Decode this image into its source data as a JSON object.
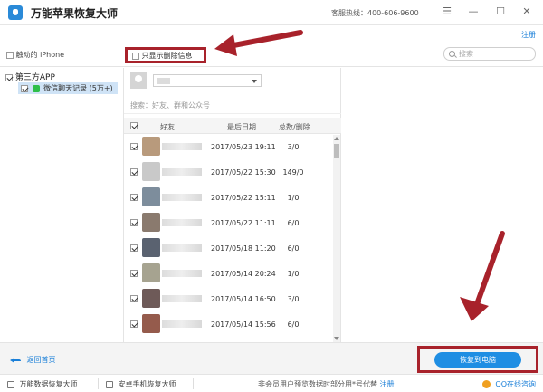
{
  "titlebar": {
    "title": "万能苹果恢复大师",
    "hotline": "客服热线：400-606-9600"
  },
  "header": {
    "register": "注册"
  },
  "toolbar": {
    "device": "触动的 iPhone",
    "only_deleted": "只显示删除信息",
    "search_placeholder": "搜索"
  },
  "sidebar": {
    "root": "第三方APP",
    "child": "微信聊天记录 (5万+)"
  },
  "chat_panel": {
    "search_placeholder": "搜索：好友、群和公众号",
    "columns": [
      "好友",
      "最后日期",
      "总数/删除"
    ],
    "rows": [
      {
        "date": "2017/05/23 19:11",
        "count": "3/0",
        "avatar_color": "#b89a7c"
      },
      {
        "date": "2017/05/22 15:30",
        "count": "149/0",
        "avatar_color": "#c9c9c9"
      },
      {
        "date": "2017/05/22 15:11",
        "count": "1/0",
        "avatar_color": "#7d8d9c"
      },
      {
        "date": "2017/05/22 11:11",
        "count": "6/0",
        "avatar_color": "#8a7a6e"
      },
      {
        "date": "2017/05/18 11:20",
        "count": "6/0",
        "avatar_color": "#5a6270"
      },
      {
        "date": "2017/05/14 20:24",
        "count": "1/0",
        "avatar_color": "#a6a390"
      },
      {
        "date": "2017/05/14 16:50",
        "count": "3/0",
        "avatar_color": "#6e5a58"
      },
      {
        "date": "2017/05/14 15:56",
        "count": "6/0",
        "avatar_color": "#955b4c"
      }
    ]
  },
  "actions": {
    "back": "返回首页",
    "restore": "恢复到电脑"
  },
  "statusbar": {
    "item1": "万能数据恢复大师",
    "item2": "安卓手机恢复大师",
    "notice": "非会员用户预览数据时部分用*号代替",
    "notice_link": "注册",
    "qq": "QQ在线咨询"
  },
  "colors": {
    "accent": "#1f8ee3",
    "annotation_red": "#a8222b"
  }
}
